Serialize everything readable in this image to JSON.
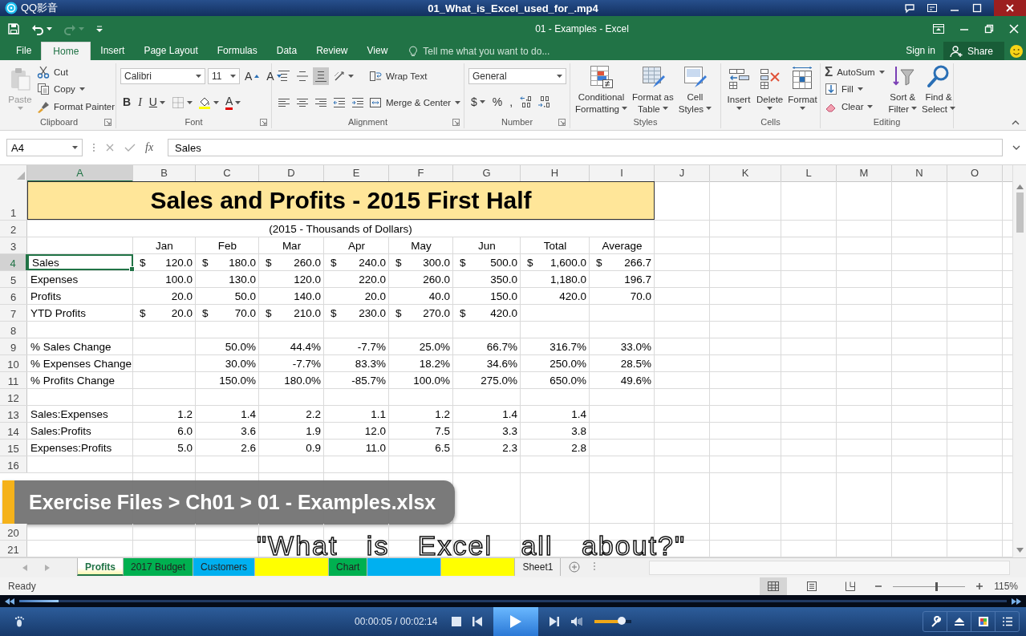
{
  "player": {
    "app_name": "QQ影音",
    "file_name": "01_What_is_Excel_used_for_.mp4"
  },
  "excel": {
    "title": "01 - Examples - Excel",
    "undo": {
      "disabled": false
    },
    "redo": {
      "disabled": true
    },
    "tabs": [
      {
        "label": "File",
        "selected": false
      },
      {
        "label": "Home",
        "selected": true
      },
      {
        "label": "Insert",
        "selected": false
      },
      {
        "label": "Page Layout",
        "selected": false
      },
      {
        "label": "Formulas",
        "selected": false
      },
      {
        "label": "Data",
        "selected": false
      },
      {
        "label": "Review",
        "selected": false
      },
      {
        "label": "View",
        "selected": false
      }
    ],
    "tell_me": "Tell me what you want to do...",
    "sign_in": "Sign in",
    "share": "Share"
  },
  "ribbon": [
    {
      "label": "Clipboard",
      "launcher": true,
      "columns": [
        [
          [
            {
              "kind": "large",
              "lines": [
                "Paste"
              ],
              "caret": true,
              "disabled": true
            }
          ]
        ],
        [
          [
            {
              "kind": "small",
              "label": "Cut"
            }
          ],
          [
            {
              "kind": "small",
              "label": "Copy",
              "caret": true
            }
          ],
          [
            {
              "kind": "small",
              "label": "Format Painter"
            }
          ]
        ]
      ]
    },
    {
      "label": "Font",
      "launcher": true,
      "columns": [
        [
          [
            {
              "kind": "fontbox",
              "value": "Calibri"
            },
            {
              "kind": "sizebox",
              "value": "11"
            },
            {
              "kind": "glyph",
              "text": "A"
            },
            {
              "kind": "glyph",
              "text": "A"
            }
          ],
          [
            {
              "kind": "glyph",
              "text": "B"
            },
            {
              "kind": "glyph",
              "text": "I"
            },
            {
              "kind": "glyph",
              "text": "U",
              "caret": true
            },
            {
              "kind": "icon",
              "caret": true
            },
            {
              "kind": "icon",
              "caret": true
            },
            {
              "kind": "glyph",
              "text": "A",
              "caret": true
            }
          ]
        ]
      ]
    },
    {
      "label": "Alignment",
      "launcher": true,
      "columns": [
        [
          [
            {
              "kind": "icon",
              "pressed": false
            },
            {
              "kind": "icon",
              "pressed": false
            },
            {
              "kind": "icon",
              "pressed": true
            },
            {
              "kind": "icon",
              "caret": true
            }
          ],
          [
            {
              "kind": "icon"
            },
            {
              "kind": "icon"
            },
            {
              "kind": "icon"
            },
            {
              "kind": "icon"
            },
            {
              "kind": "icon"
            }
          ]
        ],
        [
          [
            {
              "kind": "small",
              "label": "Wrap Text"
            }
          ],
          [
            {
              "kind": "small",
              "label": "Merge & Center",
              "caret": true
            }
          ]
        ]
      ]
    },
    {
      "label": "Number",
      "launcher": true,
      "columns": [
        [
          [
            {
              "kind": "formatbox",
              "value": "General"
            }
          ],
          [
            {
              "kind": "glyph",
              "text": "$",
              "caret": true
            },
            {
              "kind": "glyph",
              "text": "%"
            },
            {
              "kind": "glyph",
              "text": ","
            },
            {
              "kind": "icon"
            },
            {
              "kind": "icon"
            }
          ]
        ]
      ]
    },
    {
      "label": "Styles",
      "launcher": false,
      "columns": [
        [
          [
            {
              "kind": "large",
              "lines": [
                "Conditional",
                "Formatting"
              ],
              "caret": true
            }
          ]
        ],
        [
          [
            {
              "kind": "large",
              "lines": [
                "Format as",
                "Table"
              ],
              "caret": true
            }
          ]
        ],
        [
          [
            {
              "kind": "large",
              "lines": [
                "Cell",
                "Styles"
              ],
              "caret": true
            }
          ]
        ]
      ]
    },
    {
      "label": "Cells",
      "launcher": false,
      "columns": [
        [
          [
            {
              "kind": "large",
              "lines": [
                "Insert"
              ],
              "caret": true
            }
          ]
        ],
        [
          [
            {
              "kind": "large",
              "lines": [
                "Delete"
              ],
              "caret": true
            }
          ]
        ],
        [
          [
            {
              "kind": "large",
              "lines": [
                "Format"
              ],
              "caret": true
            }
          ]
        ]
      ]
    },
    {
      "label": "Editing",
      "launcher": false,
      "columns": [
        [
          [
            {
              "kind": "small",
              "symbol": "Σ",
              "label": "AutoSum",
              "caret": true
            }
          ],
          [
            {
              "kind": "small",
              "label": "Fill",
              "caret": true
            }
          ],
          [
            {
              "kind": "small",
              "label": "Clear",
              "caret": true
            }
          ]
        ],
        [
          [
            {
              "kind": "large",
              "lines": [
                "Sort &",
                "Filter"
              ],
              "caret": true
            }
          ]
        ],
        [
          [
            {
              "kind": "large",
              "lines": [
                "Find &",
                "Select"
              ],
              "caret": true
            }
          ]
        ]
      ]
    }
  ],
  "formula_bar": {
    "name_box": "A4",
    "function_label": "fx",
    "value": "Sales"
  },
  "sheet": {
    "columns": [
      {
        "label": "A",
        "selected": true
      },
      {
        "label": "B",
        "selected": false
      },
      {
        "label": "C",
        "selected": false
      },
      {
        "label": "D",
        "selected": false
      },
      {
        "label": "E",
        "selected": false
      },
      {
        "label": "F",
        "selected": false
      },
      {
        "label": "G",
        "selected": false
      },
      {
        "label": "H",
        "selected": false
      },
      {
        "label": "I",
        "selected": false
      },
      {
        "label": "J",
        "selected": false
      },
      {
        "label": "K",
        "selected": false
      },
      {
        "label": "L",
        "selected": false
      },
      {
        "label": "M",
        "selected": false
      },
      {
        "label": "N",
        "selected": false
      },
      {
        "label": "O",
        "selected": false
      }
    ],
    "rows": [
      {
        "number": "1",
        "kind": "title",
        "selected": false,
        "text": "Sales and Profits - 2015 First Half"
      },
      {
        "number": "2",
        "kind": "subtitle",
        "selected": false,
        "text": "(2015 - Thousands of Dollars)"
      },
      {
        "number": "3",
        "kind": "header",
        "selected": false,
        "cells": [
          null,
          "Jan",
          "Feb",
          "Mar",
          "Apr",
          "May",
          "Jun",
          "Total",
          "Average"
        ]
      },
      {
        "number": "4",
        "kind": "data",
        "selected": true,
        "cells": [
          "Sales",
          {
            "sym": "$",
            "text": "120.0"
          },
          {
            "sym": "$",
            "text": "180.0"
          },
          {
            "sym": "$",
            "text": "260.0"
          },
          {
            "sym": "$",
            "text": "240.0"
          },
          {
            "sym": "$",
            "text": "300.0"
          },
          {
            "sym": "$",
            "text": "500.0"
          },
          {
            "sym": "$",
            "text": "1,600.0"
          },
          {
            "sym": "$",
            "text": "266.7"
          }
        ]
      },
      {
        "number": "5",
        "kind": "data",
        "selected": false,
        "cells": [
          "Expenses",
          "100.0",
          "130.0",
          "120.0",
          "220.0",
          "260.0",
          "350.0",
          "1,180.0",
          "196.7"
        ]
      },
      {
        "number": "6",
        "kind": "data",
        "selected": false,
        "cells": [
          "Profits",
          "20.0",
          "50.0",
          "140.0",
          "20.0",
          "40.0",
          "150.0",
          "420.0",
          "70.0"
        ]
      },
      {
        "number": "7",
        "kind": "data",
        "selected": false,
        "cells": [
          "YTD Profits",
          {
            "sym": "$",
            "text": "20.0"
          },
          {
            "sym": "$",
            "text": "70.0"
          },
          {
            "sym": "$",
            "text": "210.0"
          },
          {
            "sym": "$",
            "text": "230.0"
          },
          {
            "sym": "$",
            "text": "270.0"
          },
          {
            "sym": "$",
            "text": "420.0"
          }
        ]
      },
      {
        "number": "8",
        "kind": "data",
        "selected": false,
        "cells": []
      },
      {
        "number": "9",
        "kind": "data",
        "selected": false,
        "cells": [
          "% Sales Change",
          null,
          "50.0%",
          "44.4%",
          "-7.7%",
          "25.0%",
          "66.7%",
          "316.7%",
          "33.0%"
        ]
      },
      {
        "number": "10",
        "kind": "data",
        "selected": false,
        "cells": [
          "% Expenses Change",
          null,
          "30.0%",
          "-7.7%",
          "83.3%",
          "18.2%",
          "34.6%",
          "250.0%",
          "28.5%"
        ]
      },
      {
        "number": "11",
        "kind": "data",
        "selected": false,
        "cells": [
          "% Profits Change",
          null,
          "150.0%",
          "180.0%",
          "-85.7%",
          "100.0%",
          "275.0%",
          "650.0%",
          "49.6%"
        ]
      },
      {
        "number": "12",
        "kind": "data",
        "selected": false,
        "cells": []
      },
      {
        "number": "13",
        "kind": "data",
        "selected": false,
        "cells": [
          "Sales:Expenses",
          "1.2",
          "1.4",
          "2.2",
          "1.1",
          "1.2",
          "1.4",
          "1.4"
        ]
      },
      {
        "number": "14",
        "kind": "data",
        "selected": false,
        "cells": [
          "Sales:Profits",
          "6.0",
          "3.6",
          "1.9",
          "12.0",
          "7.5",
          "3.3",
          "3.8"
        ]
      },
      {
        "number": "15",
        "kind": "data",
        "selected": false,
        "cells": [
          "Expenses:Profits",
          "5.0",
          "2.6",
          "0.9",
          "11.0",
          "6.5",
          "2.3",
          "2.8"
        ]
      },
      {
        "number": "16",
        "kind": "data",
        "selected": false,
        "cells": []
      },
      {
        "kind": "banner",
        "text": "Exercise Files > Ch01 > 01 - Examples.xlsx"
      },
      {
        "number": "20",
        "kind": "data",
        "selected": false,
        "cells": []
      },
      {
        "number": "21",
        "kind": "data",
        "selected": false,
        "cells": []
      }
    ]
  },
  "sheet_tabs": [
    {
      "label": "Profits",
      "selected": true
    },
    {
      "label": "2017 Budget",
      "selected": false,
      "color": "#00b050"
    },
    {
      "label": "Customers",
      "selected": false,
      "color": "#00b0f0"
    },
    {
      "selected": false,
      "color": "#ffff00"
    },
    {
      "label": "Chart",
      "selected": false,
      "color": "#00b050"
    },
    {
      "selected": false,
      "color": "#00b0f0"
    },
    {
      "selected": false,
      "color": "#ffff00"
    },
    {
      "label": "Sheet1",
      "selected": false
    }
  ],
  "status_bar": {
    "text": "Ready",
    "views": [
      {
        "selected": true
      },
      {
        "selected": false
      },
      {
        "selected": false
      }
    ],
    "zoom_slider": {
      "level": 0.6
    },
    "zoom": "115%"
  },
  "subtitle": "\"What is Excel all about?\"",
  "playback": {
    "progress": {
      "level": 0.04
    },
    "time": "00:00:05 / 00:02:14",
    "volume": {
      "level": 0.72
    }
  }
}
